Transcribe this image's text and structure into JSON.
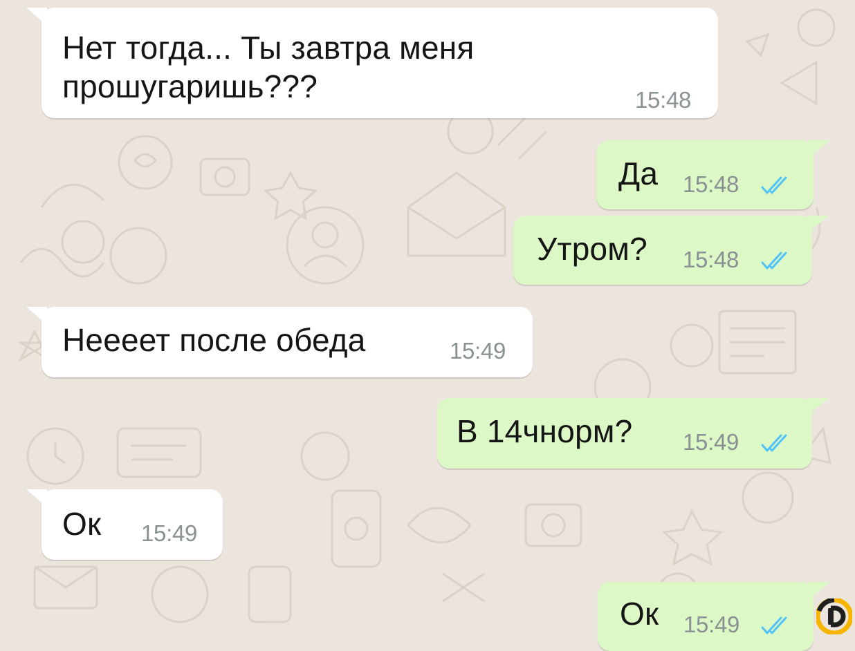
{
  "messages": [
    {
      "direction": "in",
      "text": "Нет тогда... Ты завтра меня\nпрошугаришь???",
      "time": "15:48"
    },
    {
      "direction": "out",
      "text": "Да",
      "time": "15:48",
      "status": "read"
    },
    {
      "direction": "out",
      "text": "Утром?",
      "time": "15:48",
      "status": "read"
    },
    {
      "direction": "in",
      "text": "Неееет после обеда",
      "time": "15:49"
    },
    {
      "direction": "out",
      "text": "В 14чнорм?",
      "time": "15:49",
      "status": "read"
    },
    {
      "direction": "in",
      "text": "Ок",
      "time": "15:49"
    },
    {
      "direction": "out",
      "text": "Ок",
      "time": "15:49",
      "status": "read"
    }
  ],
  "colors": {
    "background": "#ece5dd",
    "incoming_bubble": "#ffffff",
    "outgoing_bubble": "#dcf8c6",
    "read_ticks": "#4fc3f7",
    "timestamp": "#8a9192"
  },
  "icons": {
    "read_status": "double-check-icon",
    "corner_logo": "brand-logo-icon"
  }
}
